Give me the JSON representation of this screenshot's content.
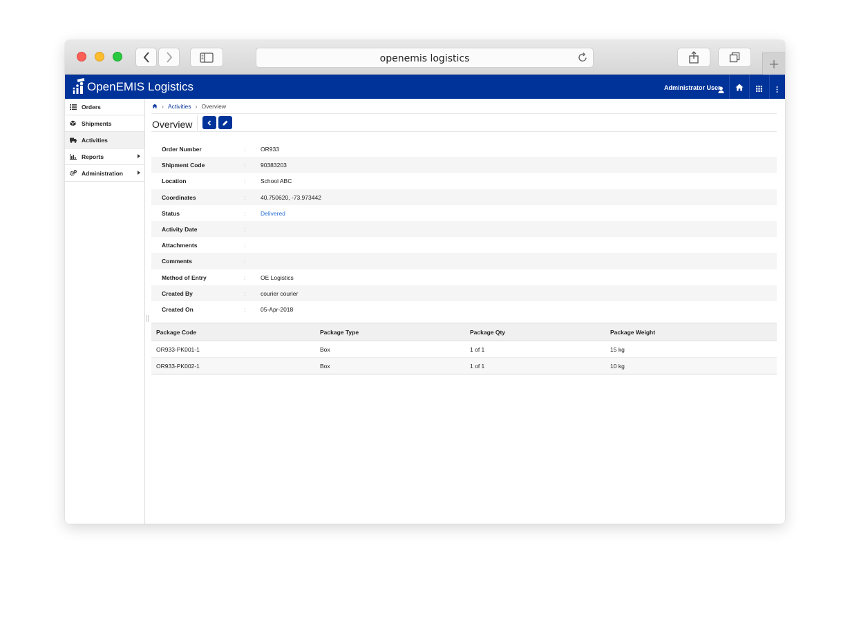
{
  "browser": {
    "url_display": "openemis logistics"
  },
  "app": {
    "title": "OpenEMIS Logistics",
    "brand_color": "#003399",
    "user_name": "Administrator User"
  },
  "sidebar": {
    "items": [
      {
        "label": "Orders",
        "icon": "list-icon"
      },
      {
        "label": "Shipments",
        "icon": "box-icon"
      },
      {
        "label": "Activities",
        "icon": "truck-icon",
        "active": true
      },
      {
        "label": "Reports",
        "icon": "bar-chart-icon",
        "has_submenu": true
      },
      {
        "label": "Administration",
        "icon": "cogs-icon",
        "has_submenu": true
      }
    ]
  },
  "breadcrumb": {
    "items": [
      "Activities",
      "Overview"
    ]
  },
  "page": {
    "title": "Overview"
  },
  "fields": [
    {
      "label": "Order Number",
      "value": "OR933"
    },
    {
      "label": "Shipment Code",
      "value": "90383203"
    },
    {
      "label": "Location",
      "value": "School ABC"
    },
    {
      "label": "Coordinates",
      "value": "40.750620, -73.973442"
    },
    {
      "label": "Status",
      "value": "Delivered"
    },
    {
      "label": "Activity Date",
      "value": ""
    },
    {
      "label": "Attachments",
      "value": ""
    },
    {
      "label": "Comments",
      "value": ""
    },
    {
      "label": "Method of Entry",
      "value": "OE Logistics"
    },
    {
      "label": "Created By",
      "value": "courier courier"
    },
    {
      "label": "Created On",
      "value": "05-Apr-2018"
    }
  ],
  "field_separator": ":",
  "packages": {
    "columns": [
      "Package Code",
      "Package Type",
      "Package Qty",
      "Package Weight"
    ],
    "rows": [
      [
        "OR933-PK001-1",
        "Box",
        "1 of 1",
        "15 kg"
      ],
      [
        "OR933-PK002-1",
        "Box",
        "1 of 1",
        "10 kg"
      ]
    ]
  }
}
